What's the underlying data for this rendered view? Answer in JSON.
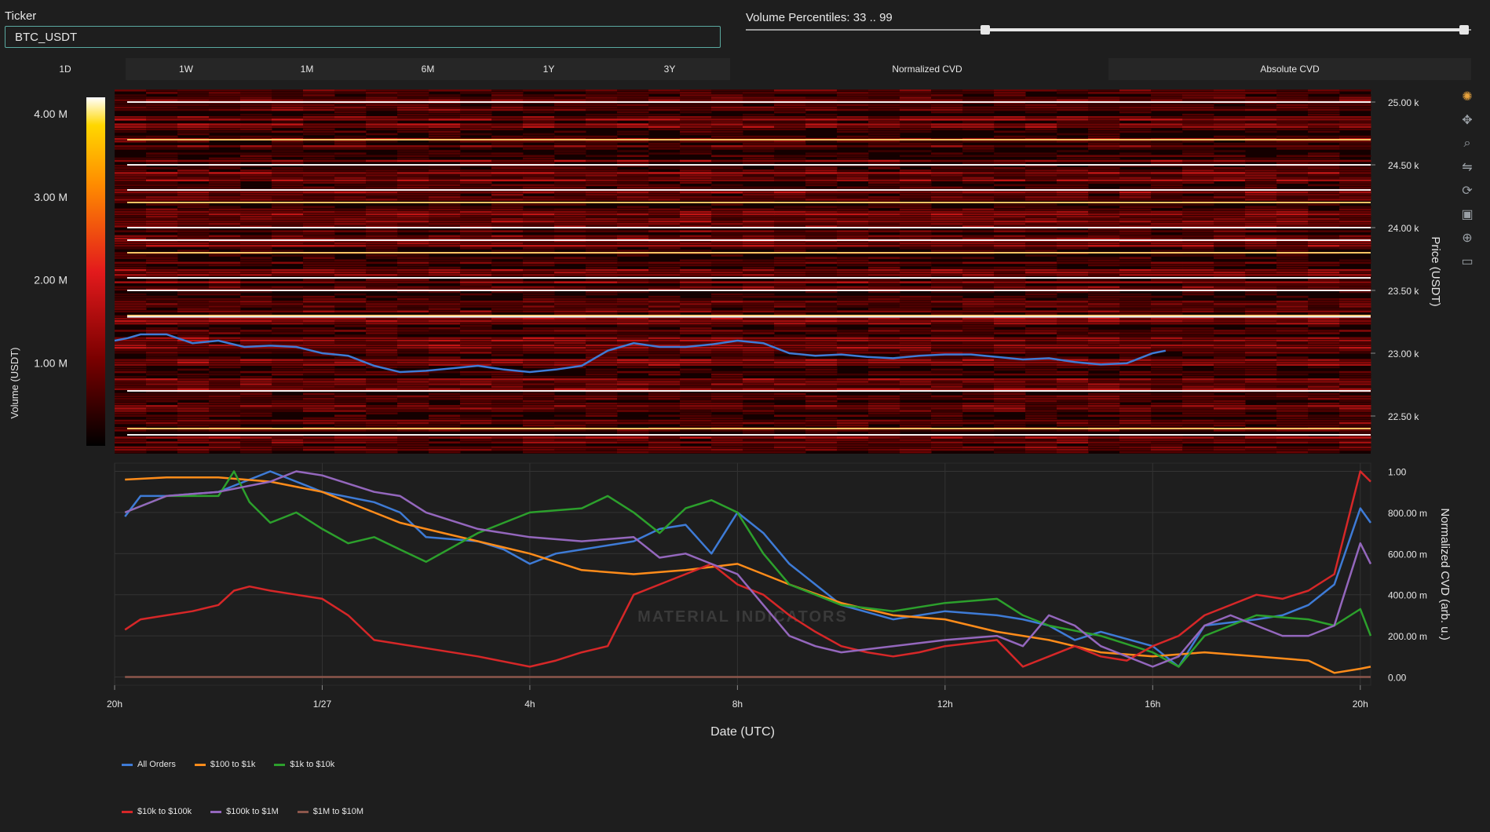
{
  "header": {
    "ticker_label": "Ticker",
    "ticker_value": "BTC_USDT",
    "volume_label": "Volume Percentiles: 33 .. 99",
    "volume_range": [
      33,
      99
    ]
  },
  "range_buttons": [
    "1D",
    "1W",
    "1M",
    "6M",
    "1Y",
    "3Y"
  ],
  "range_selected": "1D",
  "cvd_buttons": [
    "Normalized CVD",
    "Absolute CVD"
  ],
  "cvd_selected": "Normalized CVD",
  "modebar_icons": [
    "plotly-logo-icon",
    "pan-icon",
    "zoom-icon",
    "zoom-in-out-icon",
    "autoscale-icon",
    "download-icon",
    "spike-lines-icon",
    "hover-icon"
  ],
  "chart_data": [
    {
      "type": "heatmap",
      "ylabel": "Price (USDT)",
      "colorbar_label": "Volume (USDT)",
      "colorbar_ticks": [
        "1.00 M",
        "2.00 M",
        "3.00 M",
        "4.00 M"
      ],
      "colorbar_values": [
        1000000,
        2000000,
        3000000,
        4000000
      ],
      "colorbar_range": [
        0,
        4200000
      ],
      "colorscale": [
        "#000000",
        "#7a0000",
        "#e31a1c",
        "#ff8c00",
        "#ffd700",
        "#ffffff"
      ],
      "yticks": [
        "22.50 k",
        "23.00 k",
        "23.50 k",
        "24.00 k",
        "24.50 k",
        "25.00 k"
      ],
      "ytick_values": [
        22500,
        23000,
        23500,
        24000,
        24500,
        25000
      ],
      "ylim": [
        22200,
        25100
      ],
      "bright_levels": [
        25000,
        24700,
        24500,
        24300,
        24200,
        24000,
        23900,
        23800,
        23600,
        23500,
        23300,
        23290,
        22700,
        22400,
        22350
      ],
      "price_series": {
        "name": "Price",
        "color": "#3e7bd6",
        "x": [
          0,
          0.25,
          0.5,
          1,
          1.5,
          2,
          2.5,
          3,
          3.5,
          4,
          4.5,
          5,
          5.5,
          6,
          6.5,
          7,
          7.5,
          8,
          8.5,
          9,
          9.5,
          10,
          10.5,
          11,
          11.5,
          12,
          12.5,
          13,
          13.5,
          14,
          14.5,
          15,
          15.5,
          16,
          16.5,
          17,
          17.5,
          18,
          18.5,
          19,
          19.5,
          20,
          20.25
        ],
        "y": [
          23100,
          23120,
          23150,
          23150,
          23080,
          23100,
          23050,
          23060,
          23050,
          23000,
          22980,
          22900,
          22850,
          22860,
          22880,
          22900,
          22870,
          22850,
          22870,
          22900,
          23020,
          23080,
          23050,
          23050,
          23070,
          23100,
          23080,
          23000,
          22980,
          22990,
          22970,
          22960,
          22980,
          22990,
          22990,
          22970,
          22950,
          22960,
          22930,
          22910,
          22920,
          23000,
          23020
        ]
      }
    },
    {
      "type": "line",
      "xlabel": "Date (UTC)",
      "ylabel": "Normalized CVD (arb. u.)",
      "xticks": [
        "20h",
        "1/27",
        "4h",
        "8h",
        "12h",
        "16h",
        "20h"
      ],
      "xtick_values": [
        0,
        4,
        8,
        12,
        16,
        20,
        24
      ],
      "xlim": [
        0,
        24.2
      ],
      "yticks": [
        "0.00",
        "200.00 m",
        "400.00 m",
        "600.00 m",
        "800.00 m",
        "1.00"
      ],
      "ytick_values": [
        0,
        0.2,
        0.4,
        0.6,
        0.8,
        1.0
      ],
      "ylim": [
        -0.04,
        1.04
      ],
      "watermark": "MATERIAL INDICATORS",
      "series": [
        {
          "name": "All Orders",
          "color": "#3e7bd6",
          "x": [
            0.2,
            0.5,
            1,
            2,
            3,
            4,
            5,
            5.5,
            6,
            7,
            7.5,
            8,
            8.5,
            9,
            10,
            10.5,
            11,
            11.5,
            12,
            12.5,
            13,
            13.5,
            14,
            15,
            16,
            17,
            17.5,
            18,
            18.5,
            19,
            20,
            20.5,
            21,
            22,
            22.5,
            23,
            23.5,
            24,
            24.2
          ],
          "y": [
            0.78,
            0.88,
            0.88,
            0.9,
            1.0,
            0.9,
            0.85,
            0.8,
            0.68,
            0.66,
            0.62,
            0.55,
            0.6,
            0.62,
            0.66,
            0.72,
            0.74,
            0.6,
            0.8,
            0.7,
            0.55,
            0.45,
            0.35,
            0.28,
            0.32,
            0.3,
            0.28,
            0.25,
            0.18,
            0.22,
            0.15,
            0.05,
            0.25,
            0.28,
            0.3,
            0.35,
            0.45,
            0.82,
            0.75
          ]
        },
        {
          "name": "$100 to $1k",
          "color": "#ff8c1a",
          "x": [
            0.2,
            1,
            2,
            3,
            4,
            5,
            5.5,
            6,
            7,
            8,
            9,
            10,
            11,
            12,
            13,
            14,
            15,
            16,
            17,
            18,
            19,
            20,
            21,
            22,
            23,
            23.5,
            24,
            24.2
          ],
          "y": [
            0.96,
            0.97,
            0.97,
            0.95,
            0.9,
            0.8,
            0.75,
            0.72,
            0.66,
            0.6,
            0.52,
            0.5,
            0.52,
            0.55,
            0.45,
            0.36,
            0.3,
            0.28,
            0.22,
            0.18,
            0.12,
            0.1,
            0.12,
            0.1,
            0.08,
            0.02,
            0.04,
            0.05
          ]
        },
        {
          "name": "$1k to $10k",
          "color": "#2ca02c",
          "x": [
            0.2,
            1,
            2,
            2.3,
            2.6,
            3,
            3.5,
            4,
            4.5,
            5,
            5.5,
            6,
            7,
            8,
            9,
            9.5,
            10,
            10.5,
            11,
            11.5,
            12,
            12.5,
            13,
            13.5,
            14,
            15,
            16,
            17,
            17.5,
            18,
            19,
            20,
            20.5,
            21,
            22,
            23,
            23.5,
            24,
            24.2
          ],
          "y": [
            0.8,
            0.88,
            0.88,
            1.0,
            0.85,
            0.75,
            0.8,
            0.72,
            0.65,
            0.68,
            0.62,
            0.56,
            0.7,
            0.8,
            0.82,
            0.88,
            0.8,
            0.7,
            0.82,
            0.86,
            0.8,
            0.6,
            0.45,
            0.4,
            0.35,
            0.32,
            0.36,
            0.38,
            0.3,
            0.25,
            0.2,
            0.12,
            0.05,
            0.2,
            0.3,
            0.28,
            0.25,
            0.33,
            0.2
          ]
        },
        {
          "name": "$10k to $100k",
          "color": "#d62728",
          "x": [
            0.2,
            0.5,
            1,
            1.5,
            2,
            2.3,
            2.6,
            3,
            3.5,
            4,
            4.5,
            5,
            5.5,
            6,
            7,
            8,
            8.5,
            9,
            9.5,
            10,
            10.5,
            11,
            11.5,
            12,
            12.5,
            13,
            13.5,
            14,
            14.5,
            15,
            15.5,
            16,
            17,
            17.5,
            18,
            18.5,
            19,
            19.5,
            20,
            20.5,
            21,
            22,
            22.5,
            23,
            23.5,
            24,
            24.2
          ],
          "y": [
            0.23,
            0.28,
            0.3,
            0.32,
            0.35,
            0.42,
            0.44,
            0.42,
            0.4,
            0.38,
            0.3,
            0.18,
            0.16,
            0.14,
            0.1,
            0.05,
            0.08,
            0.12,
            0.15,
            0.4,
            0.45,
            0.5,
            0.55,
            0.45,
            0.4,
            0.3,
            0.22,
            0.15,
            0.12,
            0.1,
            0.12,
            0.15,
            0.18,
            0.05,
            0.1,
            0.15,
            0.1,
            0.08,
            0.15,
            0.2,
            0.3,
            0.4,
            0.38,
            0.42,
            0.5,
            1.0,
            0.95
          ]
        },
        {
          "name": "$100k to $1M",
          "color": "#9467bd",
          "x": [
            0.2,
            1,
            2,
            3,
            3.5,
            4,
            5,
            5.5,
            6,
            7,
            8,
            9,
            10,
            10.5,
            11,
            11.5,
            12,
            12.5,
            13,
            13.5,
            14,
            15,
            16,
            17,
            17.5,
            18,
            18.5,
            19,
            20,
            20.5,
            21,
            21.5,
            22,
            22.5,
            23,
            23.5,
            24,
            24.2
          ],
          "y": [
            0.8,
            0.88,
            0.9,
            0.95,
            1.0,
            0.98,
            0.9,
            0.88,
            0.8,
            0.72,
            0.68,
            0.66,
            0.68,
            0.58,
            0.6,
            0.55,
            0.5,
            0.35,
            0.2,
            0.15,
            0.12,
            0.15,
            0.18,
            0.2,
            0.15,
            0.3,
            0.25,
            0.15,
            0.05,
            0.1,
            0.25,
            0.3,
            0.25,
            0.2,
            0.2,
            0.25,
            0.65,
            0.55
          ]
        },
        {
          "name": "$1M to $10M",
          "color": "#8c564b",
          "x": [
            0.2,
            24.2
          ],
          "y": [
            0.0,
            0.0
          ]
        }
      ]
    }
  ]
}
